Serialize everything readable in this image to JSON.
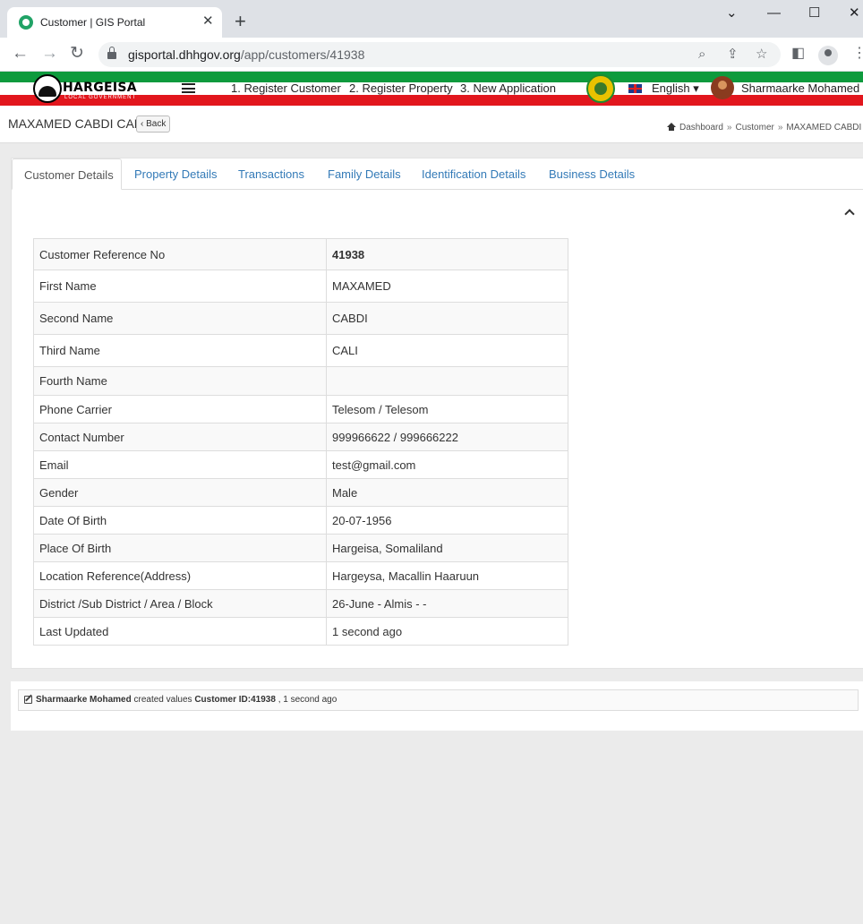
{
  "browser": {
    "tab_title": "Customer | GIS Portal",
    "url_host": "gisportal.dhhgov.org",
    "url_path": "/app/customers/41938"
  },
  "header": {
    "logo_text": "HARGEISA",
    "logo_subtext": "LOCAL GOVERNMENT",
    "nav": [
      "1. Register Customer",
      "2. Register Property",
      "3. New Application"
    ],
    "language": "English",
    "user_name": "Sharmaarke Mohamed"
  },
  "page": {
    "title": "MAXAMED CABDI CALI",
    "back_label": "Back",
    "breadcrumb": [
      "Dashboard",
      "Customer",
      "MAXAMED CABDI CALI"
    ]
  },
  "tabs": [
    "Customer Details",
    "Property Details",
    "Transactions",
    "Family Details",
    "Identification Details",
    "Business Details"
  ],
  "details": [
    {
      "label": "Customer Reference No",
      "value": "41938"
    },
    {
      "label": "First Name",
      "value": "MAXAMED"
    },
    {
      "label": "Second Name",
      "value": "CABDI"
    },
    {
      "label": "Third Name",
      "value": "CALI"
    },
    {
      "label": "Fourth Name",
      "value": ""
    },
    {
      "label": "Phone Carrier",
      "value": "Telesom / Telesom"
    },
    {
      "label": "Contact Number",
      "value": "999966622 / 999666222"
    },
    {
      "label": "Email",
      "value": "test@gmail.com"
    },
    {
      "label": "Gender",
      "value": "Male"
    },
    {
      "label": "Date Of Birth",
      "value": "20-07-1956"
    },
    {
      "label": "Place Of Birth",
      "value": "Hargeisa, Somaliland"
    },
    {
      "label": "Location Reference(Address)",
      "value": "Hargeysa, Macallin Haaruun"
    },
    {
      "label": "District /Sub District / Area / Block",
      "value": "26-June - Almis - -"
    },
    {
      "label": "Last Updated",
      "value": "1 second ago"
    }
  ],
  "activity": {
    "user": "Sharmaarke Mohamed",
    "action": "created values",
    "subject": "Customer ID:41938",
    "time": ", 1 second ago"
  },
  "colors": {
    "flag_green": "#0e9a3d",
    "flag_red": "#e2161d",
    "link_blue": "#337ab7"
  }
}
